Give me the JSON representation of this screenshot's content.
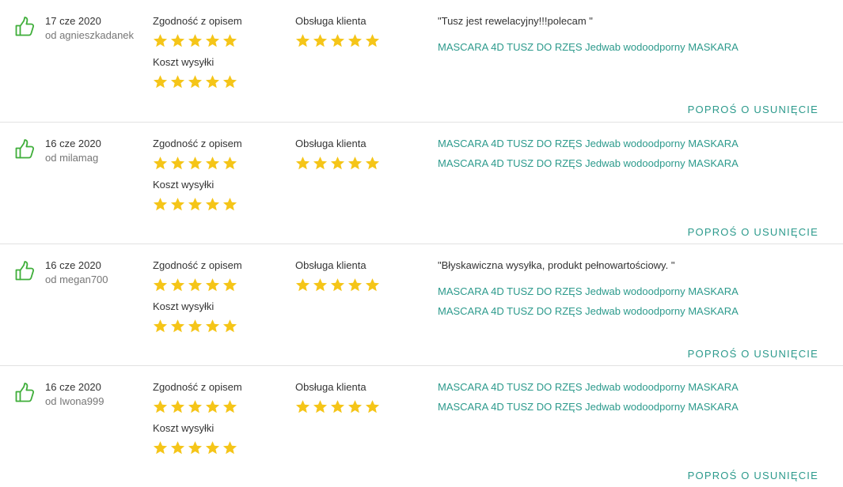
{
  "labels": {
    "description_match": "Zgodność z opisem",
    "shipping_cost": "Koszt wysyłki",
    "customer_service": "Obsługa klienta",
    "remove_request": "POPROŚ O USUNIĘCIE"
  },
  "colors": {
    "star": "#f5c518",
    "thumb": "#3fae3a",
    "link": "#2c9a8c"
  },
  "icons": {
    "thumb": "thumbs-up-icon",
    "star": "star-icon"
  },
  "reviews": [
    {
      "date": "17 cze 2020",
      "user": "od agnieszkadanek",
      "ratings": {
        "description": 5,
        "shipping": 5,
        "service": 5
      },
      "quote": "\"Tusz jest rewelacyjny!!!polecam \"",
      "products": [
        "MASCARA 4D TUSZ DO RZĘS Jedwab wodoodporny MASKARA"
      ]
    },
    {
      "date": "16 cze 2020",
      "user": "od milamag",
      "ratings": {
        "description": 5,
        "shipping": 5,
        "service": 5
      },
      "quote": "",
      "products": [
        "MASCARA 4D TUSZ DO RZĘS Jedwab wodoodporny MASKARA",
        "MASCARA 4D TUSZ DO RZĘS Jedwab wodoodporny MASKARA"
      ]
    },
    {
      "date": "16 cze 2020",
      "user": "od megan700",
      "ratings": {
        "description": 5,
        "shipping": 5,
        "service": 5
      },
      "quote": "\"Błyskawiczna wysyłka, produkt pełnowartościowy. \"",
      "products": [
        "MASCARA 4D TUSZ DO RZĘS Jedwab wodoodporny MASKARA",
        "MASCARA 4D TUSZ DO RZĘS Jedwab wodoodporny MASKARA"
      ]
    },
    {
      "date": "16 cze 2020",
      "user": "od Iwona999",
      "ratings": {
        "description": 5,
        "shipping": 5,
        "service": 5
      },
      "quote": "",
      "products": [
        "MASCARA 4D TUSZ DO RZĘS Jedwab wodoodporny MASKARA",
        "MASCARA 4D TUSZ DO RZĘS Jedwab wodoodporny MASKARA"
      ]
    }
  ]
}
